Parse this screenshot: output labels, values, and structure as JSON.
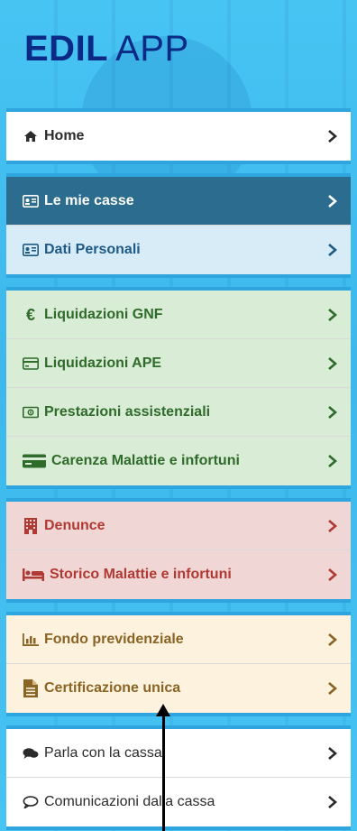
{
  "brand": {
    "word1": "EDIL",
    "word2": "APP",
    "color": "#0a2a86"
  },
  "groups": [
    {
      "items": [
        {
          "label": "Home",
          "icon": "home-icon"
        }
      ]
    },
    {
      "items": [
        {
          "label": "Le mie casse",
          "icon": "id-card-icon",
          "active": true
        },
        {
          "label": "Dati Personali",
          "icon": "id-card-icon"
        }
      ]
    },
    {
      "items": [
        {
          "label": "Liquidazioni GNF",
          "icon": "euro-icon"
        },
        {
          "label": "Liquidazioni APE",
          "icon": "credit-card-icon"
        },
        {
          "label": "Prestazioni assistenziali",
          "icon": "money-icon"
        },
        {
          "label": "Carenza Malattie e infortuni",
          "icon": "card-icon"
        }
      ]
    },
    {
      "items": [
        {
          "label": "Denunce",
          "icon": "building-icon"
        },
        {
          "label": "Storico Malattie e infortuni",
          "icon": "bed-icon"
        }
      ]
    },
    {
      "items": [
        {
          "label": "Fondo previdenziale",
          "icon": "bar-chart-icon"
        },
        {
          "label": "Certificazione unica",
          "icon": "document-icon"
        }
      ]
    },
    {
      "items": [
        {
          "label": "Parla con la cassa",
          "icon": "comments-icon"
        },
        {
          "label": "Comunicazioni dalla cassa",
          "icon": "comment-icon"
        }
      ]
    }
  ],
  "colors": {
    "active": "#2c6d8f",
    "green": "#2f6b2a",
    "red": "#b03a33",
    "yellow": "#8a6424",
    "lightblue": "#1e5a86",
    "accent_border": "#2fa5e0"
  }
}
